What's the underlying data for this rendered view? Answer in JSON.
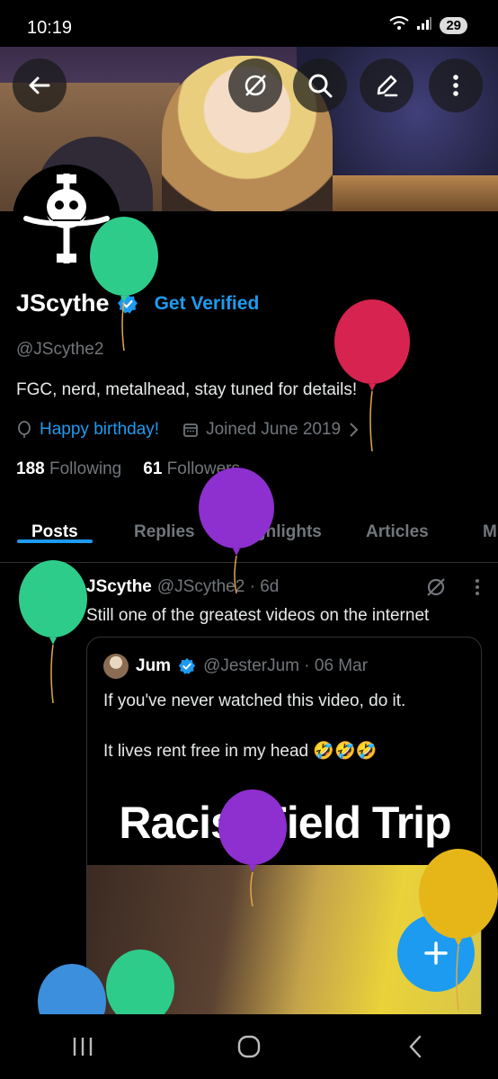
{
  "status_bar": {
    "time": "10:19",
    "battery": "29"
  },
  "profile": {
    "display_name": "JScythe",
    "get_verified": "Get Verified",
    "handle": "@JScythe2",
    "bio": "FGC, nerd, metalhead, stay tuned for details!",
    "birthday": "Happy birthday!",
    "joined": "Joined June 2019",
    "following_count": "188",
    "following_label": "Following",
    "followers_count": "61",
    "followers_label": "Followers"
  },
  "tabs": [
    "Posts",
    "Replies",
    "Highlights",
    "Articles",
    "M"
  ],
  "post": {
    "name": "JScythe",
    "handle_time": "@JScythe2 · 6d",
    "text": "Still one of the greatest videos on the internet",
    "quote": {
      "name": "Jum",
      "handle_time": "@JesterJum · 06 Mar",
      "text1": "If you've never watched this video, do it.",
      "text2": "It lives rent free in my head 🤣🤣🤣",
      "video_title": "Racist Field Trip"
    }
  },
  "colors": {
    "accent": "#1d9bf0",
    "background": "#000000",
    "muted": "#71767b"
  }
}
